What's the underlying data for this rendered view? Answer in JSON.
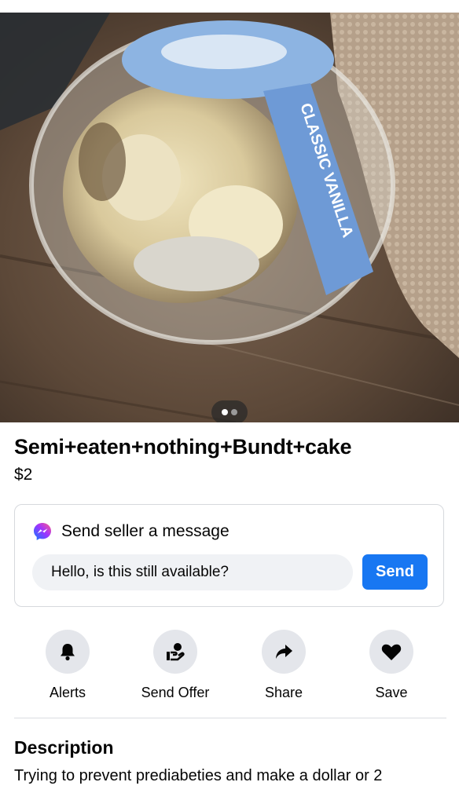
{
  "photo": {
    "label_text": "CLASSIC VANILLA",
    "pager_count": 2,
    "pager_active": 1
  },
  "listing": {
    "title": "Semi+eaten+nothing+Bundt+cake",
    "price": "$2"
  },
  "message_card": {
    "heading": "Send seller a message",
    "input_value": "Hello, is this still available?",
    "send_label": "Send"
  },
  "actions": [
    {
      "label": "Alerts",
      "icon": "bell-icon"
    },
    {
      "label": "Send Offer",
      "icon": "offer-hand-icon"
    },
    {
      "label": "Share",
      "icon": "share-arrow-icon"
    },
    {
      "label": "Save",
      "icon": "heart-icon"
    }
  ],
  "description": {
    "heading": "Description",
    "body": "Trying to prevent prediabeties and make a dollar or 2"
  },
  "colors": {
    "accent": "#1877f2",
    "icon_circle": "#e4e6eb",
    "input_bg": "#f0f2f5"
  }
}
